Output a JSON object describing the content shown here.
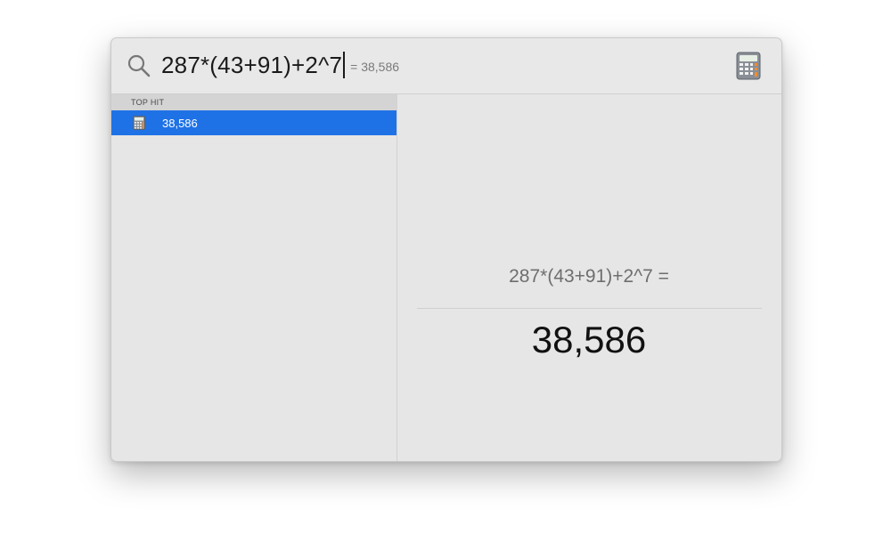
{
  "search": {
    "query": "287*(43+91)+2^7",
    "inline_result": "= 38,586",
    "app_icon": "calculator-icon"
  },
  "results": {
    "section_header": "TOP HIT",
    "top_hit": {
      "label": "38,586",
      "icon": "calculator-icon",
      "selected": true
    }
  },
  "preview": {
    "expression": "287*(43+91)+2^7 =",
    "answer": "38,586"
  },
  "colors": {
    "selection": "#1f72e6",
    "panel": "#e6e6e6"
  }
}
